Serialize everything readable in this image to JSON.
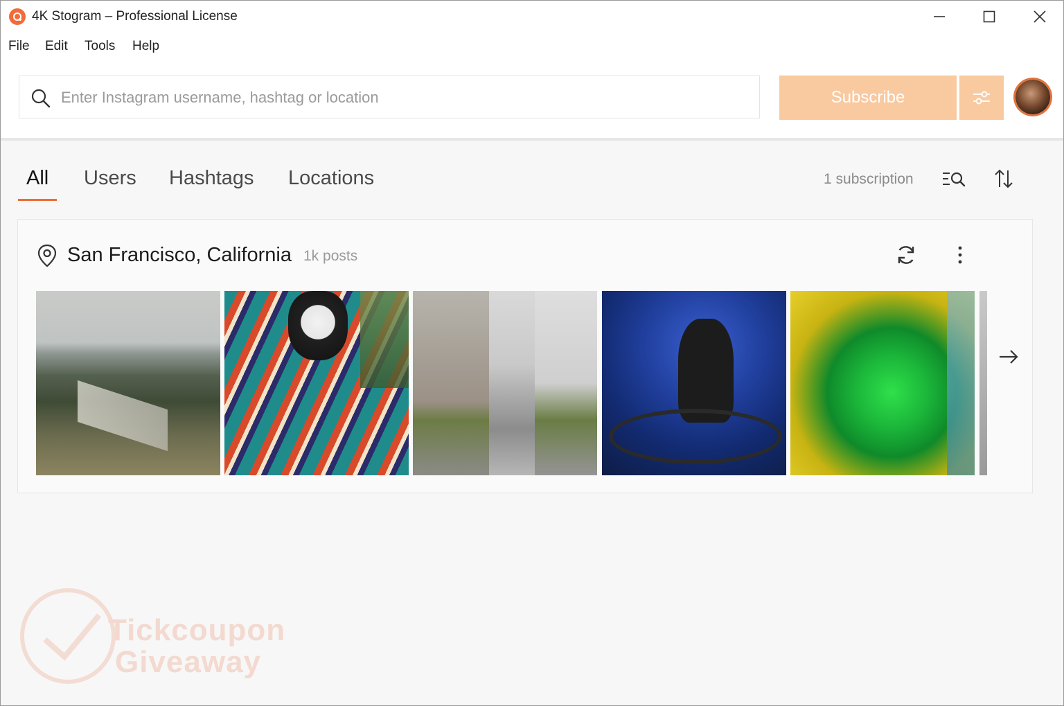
{
  "window": {
    "title": "4K Stogram – Professional License"
  },
  "menu": {
    "items": [
      "File",
      "Edit",
      "Tools",
      "Help"
    ]
  },
  "search": {
    "placeholder": "Enter Instagram username, hashtag or location",
    "value": ""
  },
  "toolbar": {
    "subscribe_label": "Subscribe",
    "settings_icon": "sliders-icon",
    "accent_color": "#f9c9a0"
  },
  "tabs": [
    {
      "label": "All",
      "active": true
    },
    {
      "label": "Users",
      "active": false
    },
    {
      "label": "Hashtags",
      "active": false
    },
    {
      "label": "Locations",
      "active": false
    }
  ],
  "subscriptions": {
    "count_label": "1 subscription"
  },
  "card": {
    "location": "San Francisco, California",
    "posts": "1k posts",
    "thumbnails": [
      {
        "subject": "hillside-view"
      },
      {
        "subject": "dog-in-blanket"
      },
      {
        "subject": "city-street"
      },
      {
        "subject": "night-bicycle"
      },
      {
        "subject": "succulent-plant"
      },
      {
        "subject": "partial-next"
      }
    ]
  },
  "watermark": {
    "line1": "Tickcoupon",
    "line2": "Giveaway"
  },
  "colors": {
    "brand_orange": "#ef6c33",
    "subscribe_disabled": "#f9c9a0"
  }
}
